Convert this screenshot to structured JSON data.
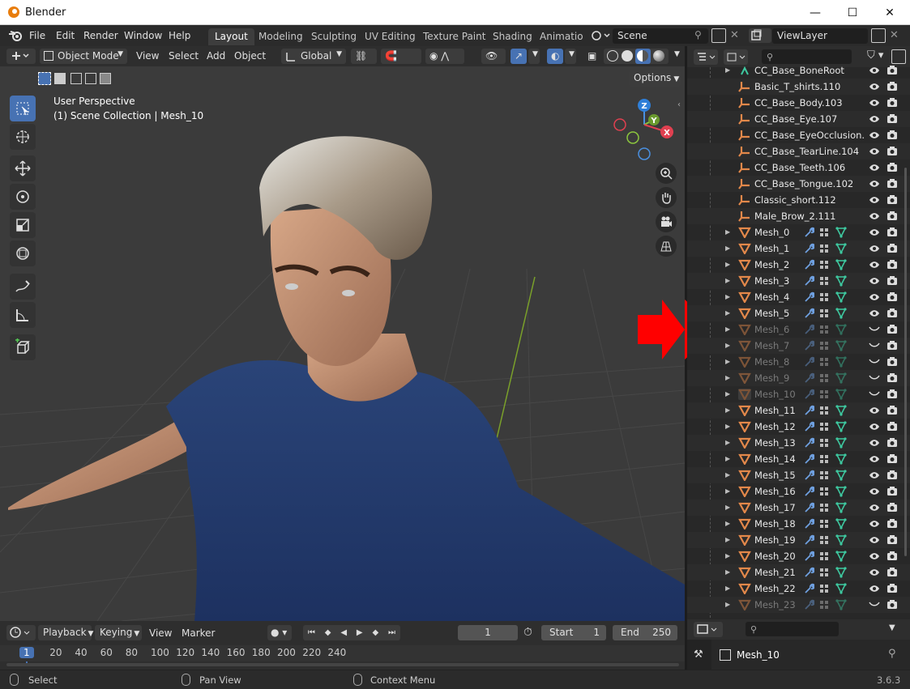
{
  "window": {
    "title": "Blender",
    "minimize": "—",
    "maximize": "☐",
    "close": "✕"
  },
  "menu": [
    "File",
    "Edit",
    "Render",
    "Window",
    "Help"
  ],
  "workspaces": [
    "Layout",
    "Modeling",
    "Sculpting",
    "UV Editing",
    "Texture Paint",
    "Shading",
    "Animation"
  ],
  "scene": {
    "name": "Scene"
  },
  "view_layer": {
    "name": "ViewLayer"
  },
  "viewport_header": {
    "mode": "Object Mode",
    "menus": [
      "View",
      "Select",
      "Add",
      "Object"
    ],
    "transform": "Global",
    "options": "Options"
  },
  "viewport": {
    "perspective": "User Perspective",
    "collection": "(1) Scene Collection | Mesh_10",
    "gizmo": {
      "z": "Z",
      "y": "Y",
      "x": "X"
    }
  },
  "outliner": {
    "items": [
      {
        "name": "CC_Base_BoneRoot",
        "type": "bone",
        "hidden": false
      },
      {
        "name": "Basic_T_shirts.110",
        "type": "armature",
        "hidden": false
      },
      {
        "name": "CC_Base_Body.103",
        "type": "armature",
        "hidden": false
      },
      {
        "name": "CC_Base_Eye.107",
        "type": "armature",
        "hidden": false
      },
      {
        "name": "CC_Base_EyeOcclusion.",
        "type": "armature",
        "hidden": false
      },
      {
        "name": "CC_Base_TearLine.104",
        "type": "armature",
        "hidden": false
      },
      {
        "name": "CC_Base_Teeth.106",
        "type": "armature",
        "hidden": false
      },
      {
        "name": "CC_Base_Tongue.102",
        "type": "armature",
        "hidden": false
      },
      {
        "name": "Classic_short.112",
        "type": "armature",
        "hidden": false
      },
      {
        "name": "Male_Brow_2.111",
        "type": "armature",
        "hidden": false
      },
      {
        "name": "Mesh_0",
        "type": "mesh",
        "hidden": false
      },
      {
        "name": "Mesh_1",
        "type": "mesh",
        "hidden": false
      },
      {
        "name": "Mesh_2",
        "type": "mesh",
        "hidden": false
      },
      {
        "name": "Mesh_3",
        "type": "mesh",
        "hidden": false
      },
      {
        "name": "Mesh_4",
        "type": "mesh",
        "hidden": false
      },
      {
        "name": "Mesh_5",
        "type": "mesh",
        "hidden": false
      },
      {
        "name": "Mesh_6",
        "type": "mesh",
        "hidden": true
      },
      {
        "name": "Mesh_7",
        "type": "mesh",
        "hidden": true
      },
      {
        "name": "Mesh_8",
        "type": "mesh",
        "hidden": true
      },
      {
        "name": "Mesh_9",
        "type": "mesh",
        "hidden": true
      },
      {
        "name": "Mesh_10",
        "type": "mesh",
        "hidden": true,
        "active": true
      },
      {
        "name": "Mesh_11",
        "type": "mesh",
        "hidden": false
      },
      {
        "name": "Mesh_12",
        "type": "mesh",
        "hidden": false
      },
      {
        "name": "Mesh_13",
        "type": "mesh",
        "hidden": false
      },
      {
        "name": "Mesh_14",
        "type": "mesh",
        "hidden": false
      },
      {
        "name": "Mesh_15",
        "type": "mesh",
        "hidden": false
      },
      {
        "name": "Mesh_16",
        "type": "mesh",
        "hidden": false
      },
      {
        "name": "Mesh_17",
        "type": "mesh",
        "hidden": false
      },
      {
        "name": "Mesh_18",
        "type": "mesh",
        "hidden": false
      },
      {
        "name": "Mesh_19",
        "type": "mesh",
        "hidden": false
      },
      {
        "name": "Mesh_20",
        "type": "mesh",
        "hidden": false
      },
      {
        "name": "Mesh_21",
        "type": "mesh",
        "hidden": false
      },
      {
        "name": "Mesh_22",
        "type": "mesh",
        "hidden": false
      },
      {
        "name": "Mesh_23",
        "type": "mesh",
        "hidden": true
      }
    ]
  },
  "timeline": {
    "menus": [
      "Playback",
      "Keying",
      "View",
      "Marker"
    ],
    "current_frame": "1",
    "start_label": "Start",
    "start": "1",
    "end_label": "End",
    "end": "250",
    "ruler": [
      "1",
      "20",
      "40",
      "60",
      "80",
      "100",
      "120",
      "140",
      "160",
      "180",
      "200",
      "220",
      "240"
    ]
  },
  "properties": {
    "object_name": "Mesh_10"
  },
  "status": {
    "select": "Select",
    "pan": "Pan View",
    "context": "Context Menu",
    "version": "3.6.3"
  },
  "colors": {
    "accent": "#4772b3",
    "orange": "#e3884a",
    "mesh_data": "#3ec9a0",
    "modifier": "#6fa0e0",
    "arrow": "#ff0000"
  }
}
